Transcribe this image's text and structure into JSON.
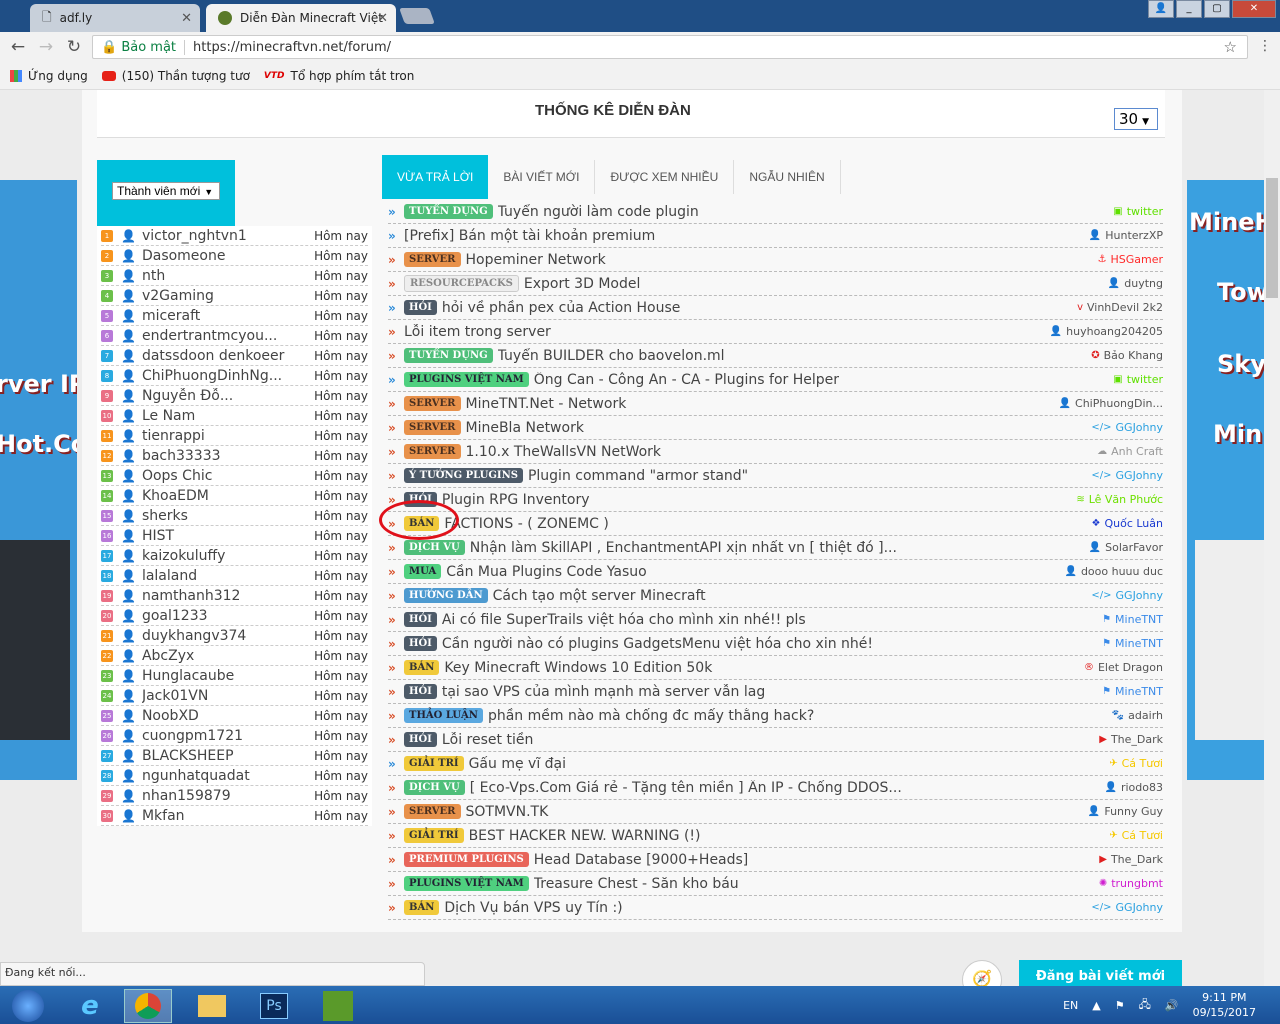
{
  "browser": {
    "tabs": [
      {
        "title": "adf.ly"
      },
      {
        "title": "Diễn Đàn Minecraft Việt"
      }
    ],
    "secure_label": "Bảo mật",
    "url": "https://minecraftvn.net/forum/",
    "bookmarks": [
      {
        "label": "Ứng dụng",
        "icon": "apps-icon"
      },
      {
        "label": "(150) Thần tượng tươ",
        "icon": "youtube-icon"
      },
      {
        "label": "Tổ hợp phím tắt tron",
        "icon": "vtd-icon"
      }
    ],
    "status": "Đang kết nối..."
  },
  "banners": {
    "left": [
      "rver IP",
      "Hot.Com"
    ],
    "right": [
      "MineHot",
      "Town",
      "Sky",
      "Minig"
    ]
  },
  "stats": {
    "title": "THỐNG KÊ DIỄN ĐÀN",
    "count": "30"
  },
  "members": {
    "filter": "Thành viên mới",
    "rank_colors": [
      "#f7941d",
      "#6cc04a",
      "#b879d8",
      "#2aaae0",
      "#ea6f84"
    ],
    "items": [
      {
        "rank": "1",
        "name": "victor_nghtvn1",
        "time": "Hôm nay"
      },
      {
        "rank": "2",
        "name": "Dasomeone",
        "time": "Hôm nay"
      },
      {
        "rank": "3",
        "name": "nth",
        "time": "Hôm nay"
      },
      {
        "rank": "4",
        "name": "v2Gaming",
        "time": "Hôm nay"
      },
      {
        "rank": "5",
        "name": "miceraft",
        "time": "Hôm nay"
      },
      {
        "rank": "6",
        "name": "endertrantmcyou...",
        "time": "Hôm nay"
      },
      {
        "rank": "7",
        "name": "datssdoon denkoeer",
        "time": "Hôm nay"
      },
      {
        "rank": "8",
        "name": "ChiPhuongDinhNg...",
        "time": "Hôm nay"
      },
      {
        "rank": "9",
        "name": "Nguyễn Đỗ...",
        "time": "Hôm nay"
      },
      {
        "rank": "10",
        "name": "Le Nam",
        "time": "Hôm nay"
      },
      {
        "rank": "11",
        "name": "tienrappi",
        "time": "Hôm nay"
      },
      {
        "rank": "12",
        "name": "bach33333",
        "time": "Hôm nay"
      },
      {
        "rank": "13",
        "name": "Oops Chic",
        "time": "Hôm nay"
      },
      {
        "rank": "14",
        "name": "KhoaEDM",
        "time": "Hôm nay"
      },
      {
        "rank": "15",
        "name": "sherks",
        "time": "Hôm nay"
      },
      {
        "rank": "16",
        "name": "HIST",
        "time": "Hôm nay"
      },
      {
        "rank": "17",
        "name": "kaizokuluffy",
        "time": "Hôm nay"
      },
      {
        "rank": "18",
        "name": "lalaland",
        "time": "Hôm nay"
      },
      {
        "rank": "19",
        "name": "namthanh312",
        "time": "Hôm nay"
      },
      {
        "rank": "20",
        "name": "goal1233",
        "time": "Hôm nay"
      },
      {
        "rank": "21",
        "name": "duykhangv374",
        "time": "Hôm nay"
      },
      {
        "rank": "22",
        "name": "AbcZyx",
        "time": "Hôm nay"
      },
      {
        "rank": "23",
        "name": "Hunglacaube",
        "time": "Hôm nay"
      },
      {
        "rank": "24",
        "name": "Jack01VN",
        "time": "Hôm nay"
      },
      {
        "rank": "25",
        "name": "NoobXD",
        "time": "Hôm nay"
      },
      {
        "rank": "26",
        "name": "cuongpm1721",
        "time": "Hôm nay"
      },
      {
        "rank": "27",
        "name": "BLACKSHEEP",
        "time": "Hôm nay"
      },
      {
        "rank": "28",
        "name": "ngunhatquadat",
        "time": "Hôm nay"
      },
      {
        "rank": "29",
        "name": "nhan159879",
        "time": "Hôm nay"
      },
      {
        "rank": "30",
        "name": "Mkfan",
        "time": "Hôm nay"
      }
    ]
  },
  "thread_tabs": [
    {
      "label": "VỪA TRẢ LỜI",
      "active": true
    },
    {
      "label": "BÀI VIẾT MỚI"
    },
    {
      "label": "ĐƯỢC XEM NHIỀU"
    },
    {
      "label": "NGẪU NHIÊN"
    }
  ],
  "badge_styles": {
    "TUYỂN DỤNG": [
      "#4fbf7a",
      "#fff"
    ],
    "SERVER": [
      "#e8914a",
      "#4a3020"
    ],
    "RESOURCEPACKS": [
      "#eeeeee",
      "#888"
    ],
    "HỎI": [
      "#4d5a68",
      "#fff"
    ],
    "PLUGINS VIỆT NAM": [
      "#4fd07f",
      "#223"
    ],
    "Ý TƯỞNG PLUGINS": [
      "#4d5a68",
      "#fff"
    ],
    "BÁN": [
      "#f0c93a",
      "#333"
    ],
    "DỊCH VỤ": [
      "#4fbf7a",
      "#fff"
    ],
    "MUA": [
      "#4fd07f",
      "#223"
    ],
    "HƯỚNG DẪN": [
      "#4d9ad0",
      "#fff"
    ],
    "THẢO LUẬN": [
      "#5aa8e0",
      "#223"
    ],
    "GIẢI TRÍ": [
      "#f0c93a",
      "#333"
    ],
    "PREMIUM PLUGINS": [
      "#e8655a",
      "#fff"
    ]
  },
  "threads": [
    {
      "arrow": "blue",
      "badge": "TUYỂN DỤNG",
      "title": "Tuyển người làm code plugin",
      "author": "twitter",
      "icon": "twitter-icon",
      "color": "#5fe000",
      "glyph": "▣"
    },
    {
      "arrow": "blue",
      "badge": "",
      "title": "[Prefix] Bán một tài khoản premium",
      "author": "HunterzXP",
      "icon": "user-icon",
      "color": "#555",
      "glyph": "👤"
    },
    {
      "arrow": "red",
      "badge": "SERVER",
      "title": "Hopeminer Network",
      "author": "HSGamer",
      "icon": "anchor-icon",
      "color": "#ff2a2a",
      "glyph": "⚓"
    },
    {
      "arrow": "red",
      "badge": "RESOURCEPACKS",
      "title": "Export 3D Model",
      "author": "duytng",
      "icon": "user-icon",
      "color": "#555",
      "glyph": "👤"
    },
    {
      "arrow": "blue",
      "badge": "HỎI",
      "title": "hỏi về phần pex của Action House",
      "author": "VinhDevil 2k2",
      "icon": "vimeo-icon",
      "color": "#555",
      "glyph": "v"
    },
    {
      "arrow": "red",
      "badge": "",
      "title": "Lỗi item trong server",
      "author": "huyhoang204205",
      "icon": "user-icon",
      "color": "#555",
      "glyph": "👤"
    },
    {
      "arrow": "red",
      "badge": "TUYỂN DỤNG",
      "title": "Tuyển BUILDER cho baovelon.ml",
      "author": "Bảo Khang",
      "icon": "rebel-icon",
      "color": "#555",
      "glyph": "✪"
    },
    {
      "arrow": "blue",
      "badge": "PLUGINS VIỆT NAM",
      "title": "Ông Can - Công An - CA - Plugins for Helper",
      "author": "twitter",
      "icon": "twitter-icon",
      "color": "#5fe000",
      "glyph": "▣"
    },
    {
      "arrow": "red",
      "badge": "SERVER",
      "title": "MineTNT.Net - Network",
      "author": "ChiPhuongDin...",
      "icon": "user-icon",
      "color": "#555",
      "glyph": "👤"
    },
    {
      "arrow": "red",
      "badge": "SERVER",
      "title": "MineBla Network",
      "author": "GGJohny",
      "icon": "code-icon",
      "color": "#2aa0e0",
      "glyph": "</>"
    },
    {
      "arrow": "red",
      "badge": "SERVER",
      "title": "1.10.x TheWallsVN NetWork",
      "author": "Anh Craft",
      "icon": "cloud-icon",
      "color": "#999",
      "glyph": "☁"
    },
    {
      "arrow": "red",
      "badge": "Ý TƯỞNG PLUGINS",
      "title": "Plugin command \"armor stand\"",
      "author": "GGJohny",
      "icon": "code-icon",
      "color": "#2aa0e0",
      "glyph": "</>"
    },
    {
      "arrow": "red",
      "badge": "HỎI",
      "title": "Plugin RPG Inventory",
      "author": "Lê Văn Phước",
      "icon": "rss-icon",
      "color": "#6ee000",
      "glyph": "≋"
    },
    {
      "arrow": "red",
      "badge": "BÁN",
      "title": "FACTIONS - ( ZONEMC )",
      "author": "Quốc Luân",
      "icon": "cubes-icon",
      "color": "#1a3ad0",
      "glyph": "❖"
    },
    {
      "arrow": "red",
      "badge": "DỊCH VỤ",
      "title": "Nhận làm SkillAPI , EnchantmentAPI xịn nhất vn [ thiệt đó ]...",
      "author": "SolarFavor",
      "icon": "user-icon",
      "color": "#555",
      "glyph": "👤"
    },
    {
      "arrow": "red",
      "badge": "MUA",
      "title": "Cần Mua Plugins Code Yasuo",
      "author": "dooo huuu duc",
      "icon": "user-icon",
      "color": "#555",
      "glyph": "👤"
    },
    {
      "arrow": "red",
      "badge": "HƯỚNG DẪN",
      "title": "Cách tạo một server Minecraft",
      "author": "GGJohny",
      "icon": "code-icon",
      "color": "#2aa0e0",
      "glyph": "</>"
    },
    {
      "arrow": "red",
      "badge": "HỎI",
      "title": "Ai có file SuperTrails việt hóa cho mình xin nhé!! pls",
      "author": "MineTNT",
      "icon": "foursquare-icon",
      "color": "#3a8ae8",
      "glyph": "⚑"
    },
    {
      "arrow": "red",
      "badge": "HỎI",
      "title": "Cần người nào có plugins GadgetsMenu việt hóa cho xin nhé!",
      "author": "MineTNT",
      "icon": "foursquare-icon",
      "color": "#3a8ae8",
      "glyph": "⚑"
    },
    {
      "arrow": "red",
      "badge": "BÁN",
      "title": "Key Minecraft Windows 10 Edition 50k",
      "author": "Elet Dragon",
      "icon": "registered-icon",
      "color": "#555",
      "glyph": "®"
    },
    {
      "arrow": "red",
      "badge": "HỎI",
      "title": "tại sao VPS của mình mạnh mà server vẫn lag",
      "author": "MineTNT",
      "icon": "foursquare-icon",
      "color": "#3a8ae8",
      "glyph": "⚑"
    },
    {
      "arrow": "red",
      "badge": "THẢO LUẬN",
      "title": "phần mềm nào mà chống đc mấy thằng hack?",
      "author": "adairh",
      "icon": "paw-icon",
      "color": "#555",
      "glyph": "🐾"
    },
    {
      "arrow": "red",
      "badge": "HỎI",
      "title": "Lỗi reset tiền",
      "author": "The_Dark",
      "icon": "youtube-icon",
      "color": "#555",
      "glyph": "▶"
    },
    {
      "arrow": "blue",
      "badge": "GIẢI TRÍ",
      "title": "Gấu mẹ vĩ đại",
      "author": "Cá Tươi",
      "icon": "bird-icon",
      "color": "#f5c800",
      "glyph": "✈"
    },
    {
      "arrow": "red",
      "badge": "DỊCH VỤ",
      "title": "[ Eco-Vps.Com Giá rẻ - Tặng tên miền ] Ẩn IP - Chống DDOS...",
      "author": "riodo83",
      "icon": "user-icon",
      "color": "#555",
      "glyph": "👤"
    },
    {
      "arrow": "red",
      "badge": "SERVER",
      "title": "SOTMVN.TK",
      "author": "Funny Guy",
      "icon": "user-icon",
      "color": "#555",
      "glyph": "👤"
    },
    {
      "arrow": "red",
      "badge": "GIẢI TRÍ",
      "title": "BEST HACKER NEW. WARNING (!)",
      "author": "Cá Tươi",
      "icon": "bird-icon",
      "color": "#f5c800",
      "glyph": "✈"
    },
    {
      "arrow": "red",
      "badge": "PREMIUM PLUGINS",
      "title": "Head Database [9000+Heads]",
      "author": "The_Dark",
      "icon": "youtube-icon",
      "color": "#555",
      "glyph": "▶"
    },
    {
      "arrow": "red",
      "badge": "PLUGINS VIỆT NAM",
      "title": "Treasure Chest - Săn kho báu",
      "author": "trungbmt",
      "icon": "gear-icon",
      "color": "#d020d0",
      "glyph": "✺"
    },
    {
      "arrow": "red",
      "badge": "BÁN",
      "title": "Dịch Vụ bán VPS uy Tín :)",
      "author": "GGJohny",
      "icon": "code-icon",
      "color": "#2aa0e0",
      "glyph": "</>"
    }
  ],
  "actions": {
    "new_post": "Đăng bài viết mới"
  },
  "taskbar": {
    "lang": "EN",
    "time": "9:11 PM",
    "date": "09/15/2017",
    "apps": [
      "start",
      "ie",
      "chrome",
      "explorer",
      "Ps",
      "corel"
    ]
  }
}
